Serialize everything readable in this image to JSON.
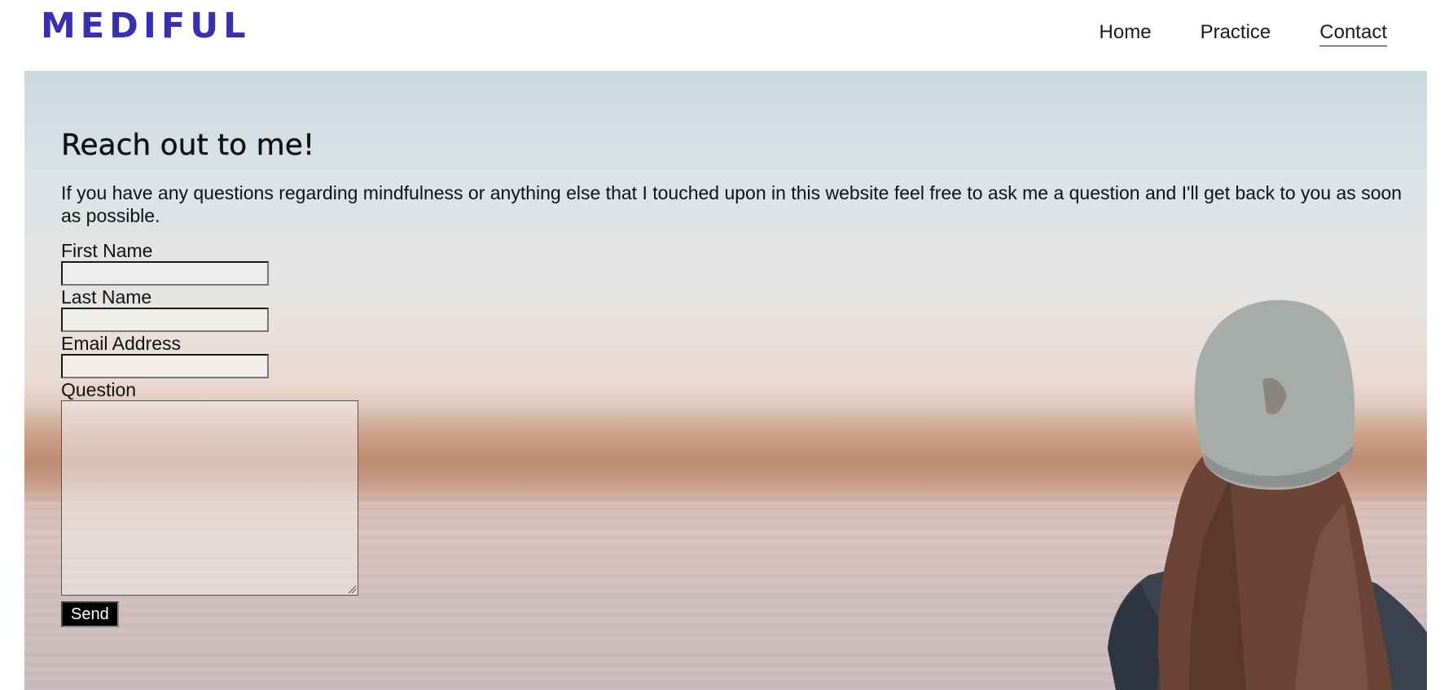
{
  "brand": {
    "logo_text": "MEDIFUL",
    "color": "#3a2fb0"
  },
  "nav": {
    "items": [
      {
        "label": "Home",
        "active": false
      },
      {
        "label": "Practice",
        "active": false
      },
      {
        "label": "Contact",
        "active": true
      }
    ]
  },
  "contact": {
    "heading": "Reach out to me!",
    "intro": "If you have any questions regarding mindfulness or anything else that I touched upon in this website feel free to ask me a question and I'll get back to you as soon as possible.",
    "fields": {
      "first_name": {
        "label": "First Name",
        "value": ""
      },
      "last_name": {
        "label": "Last Name",
        "value": ""
      },
      "email": {
        "label": "Email Address",
        "value": ""
      },
      "question": {
        "label": "Question",
        "value": ""
      }
    },
    "send_label": "Send"
  },
  "background": {
    "image": "woman-in-beanie-looking-at-lake-icon"
  }
}
